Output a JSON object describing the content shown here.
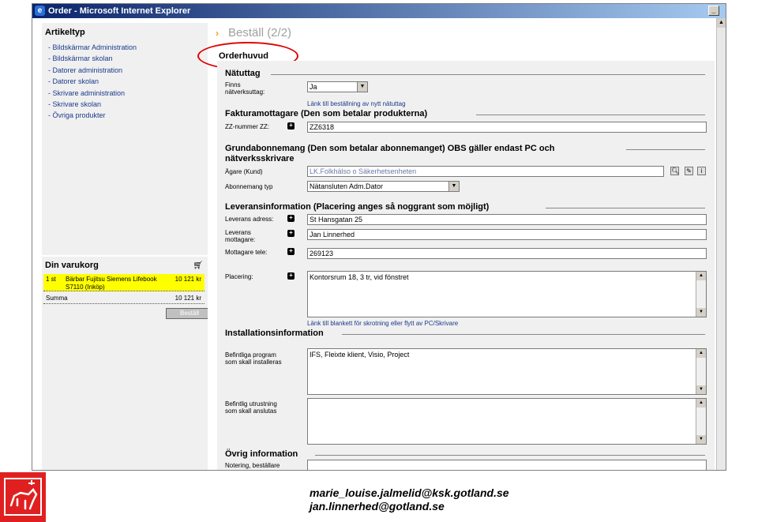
{
  "window": {
    "title": "Order - Microsoft Internet Explorer"
  },
  "sidebar": {
    "title": "Artikeltyp",
    "items": [
      "Bildskärmar Administration",
      "Bildskärmar skolan",
      "Datorer administration",
      "Datorer skolan",
      "Skrivare administration",
      "Skrivare skolan",
      "Övriga produkter"
    ]
  },
  "cart": {
    "title": "Din varukorg",
    "row": {
      "qty": "1 st",
      "item": "Bärbar Fujitsu Siemens Lifebook S7110 (Inköp)",
      "price": "10 121 kr"
    },
    "sum_label": "Summa",
    "sum_value": "10 121 kr",
    "button": "Beställ"
  },
  "page": {
    "title": "Beställ (2/2)",
    "section_head": "Orderhuvud"
  },
  "form": {
    "natuttag": {
      "heading": "Nätuttag",
      "label": "Finns nätverksuttag:",
      "value": "Ja",
      "link": "Länk till beställning av nytt nätuttag"
    },
    "faktura": {
      "heading": "Fakturamottagare (Den som betalar produkterna)",
      "label": "ZZ-nummer ZZ:",
      "value": "ZZ6318"
    },
    "grund": {
      "heading_line1": "Grundabonnemang (Den som betalar abonnemanget) OBS gäller endast PC och",
      "heading_line2": "nätverksskrivare",
      "owner_label": "Ägare (Kund)",
      "owner_value": "LK.Folkhälso o Säkerhetsenheten",
      "type_label": "Abonnemang typ",
      "type_value": "Nätansluten Adm.Dator"
    },
    "leverans": {
      "heading": "Leveransinformation (Placering anges så noggrant som möjligt)",
      "address_label": "Leverans adress:",
      "address_value": "St Hansgatan 25",
      "receiver_label": "Leverans mottagare:",
      "receiver_value": "Jan Linnerhed",
      "phone_label": "Mottagare tele:",
      "phone_value": "269123",
      "placement_label": "Placering:",
      "placement_value": "Kontorsrum 18, 3 tr, vid fönstret",
      "link": "Länk till blankett för skrotning eller flytt av PC/Skrivare"
    },
    "install": {
      "heading": "Installationsinformation",
      "programs_label": "Befintliga program som skall installeras",
      "programs_value": "IFS, Fleixte klient, Visio, Project",
      "equipment_label": "Befintlig utrustning som skall anslutas",
      "equipment_value": ""
    },
    "other": {
      "heading": "Övrig information",
      "note_label": "Notering, beställare"
    }
  },
  "footer": {
    "email1": "marie_louise.jalmelid@ksk.gotland.se",
    "email2": "jan.linnerhed@gotland.se"
  },
  "colors": {
    "titlebar": "#0a246a",
    "link": "#1a3a8a",
    "highlight": "#ffff00",
    "annotation": "#e00000",
    "logo": "#e02020"
  }
}
